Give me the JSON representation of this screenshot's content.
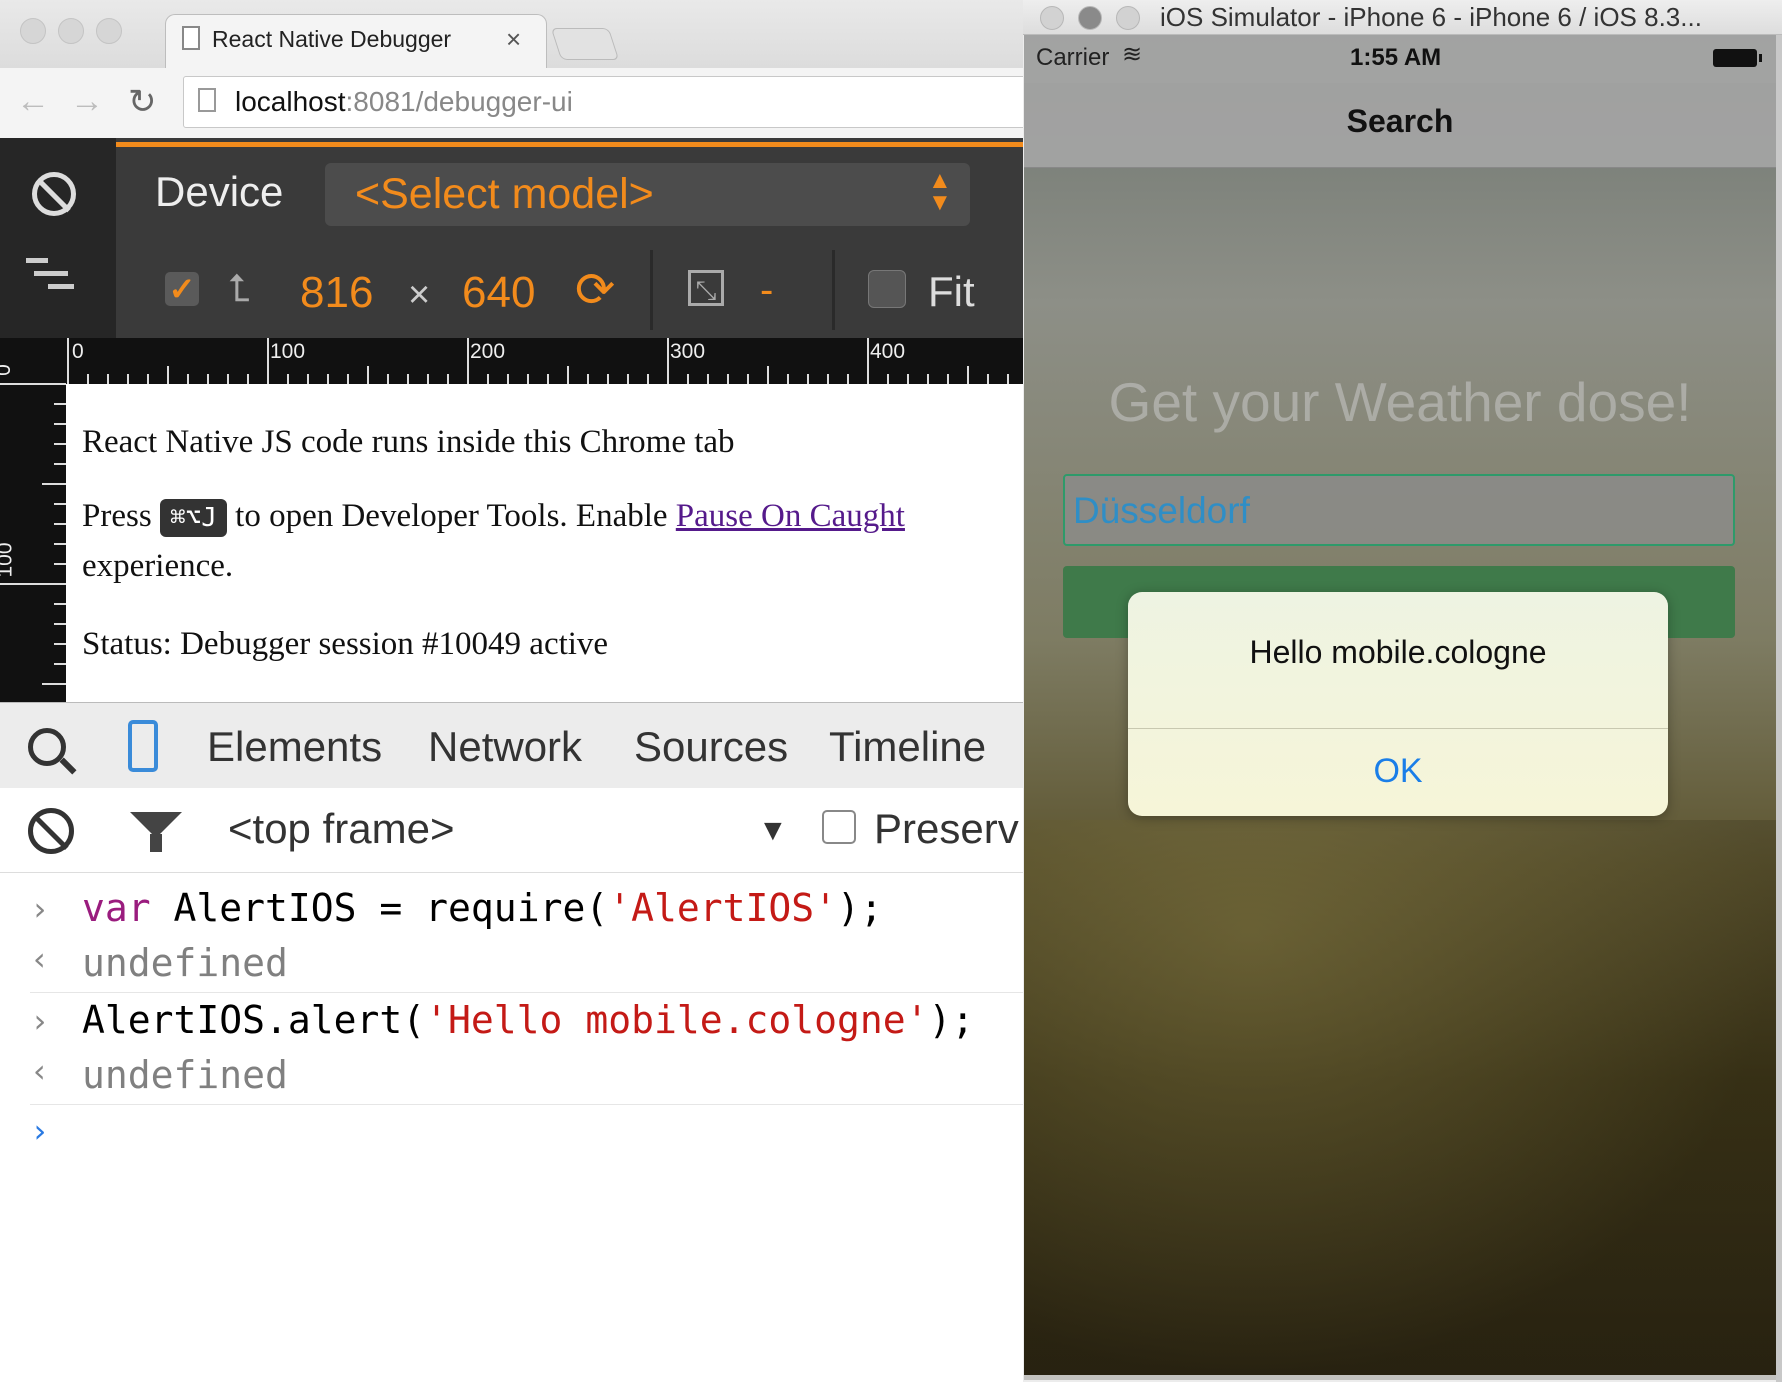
{
  "chrome": {
    "tab_title": "React Native Debugger",
    "tab_close": "×",
    "url_host": "localhost",
    "url_rest": ":8081/debugger-ui",
    "device_toolbar": {
      "device_label": "Device",
      "model_select": "<Select model>",
      "width": "816",
      "times": "×",
      "height": "640",
      "zoom_value": "-",
      "fit_label": "Fit",
      "emulation_enabled": true
    },
    "ruler": {
      "h_labels": [
        "0",
        "100",
        "200",
        "300",
        "400"
      ],
      "v_labels": [
        "0",
        "100"
      ]
    },
    "page": {
      "line1": "React Native JS code runs inside this Chrome tab",
      "line2_prefix": "Press",
      "shortcut": "⌘⌥J",
      "line2_mid": "to open Developer Tools. Enable",
      "link": "Pause On Caught",
      "line3": "experience.",
      "status": "Status: Debugger session #10049 active"
    },
    "devtools": {
      "tabs": [
        "Elements",
        "Network",
        "Sources",
        "Timeline"
      ],
      "frame": "<top frame>",
      "preserve_label": "Preserv",
      "console": {
        "in1_kw": "var",
        "in1_a": " AlertIOS = require(",
        "in1_str": "'AlertIOS'",
        "in1_b": ");",
        "out1": "undefined",
        "in2_a": "AlertIOS.alert(",
        "in2_str": "'Hello mobile.cologne'",
        "in2_b": ");",
        "out2": "undefined"
      }
    }
  },
  "simulator": {
    "window_title": "iOS Simulator - iPhone 6 - iPhone 6 / iOS 8.3...",
    "carrier": "Carrier",
    "time": "1:55 AM",
    "nav_title": "Search",
    "tagline": "Get your Weather dose!",
    "city_value": "Düsseldorf",
    "alert": {
      "message": "Hello mobile.cologne",
      "button": "OK"
    }
  },
  "colors": {
    "accent_orange": "#f28b1c",
    "ios_blue": "#1a7ee8",
    "input_border": "#2e9a6a"
  }
}
